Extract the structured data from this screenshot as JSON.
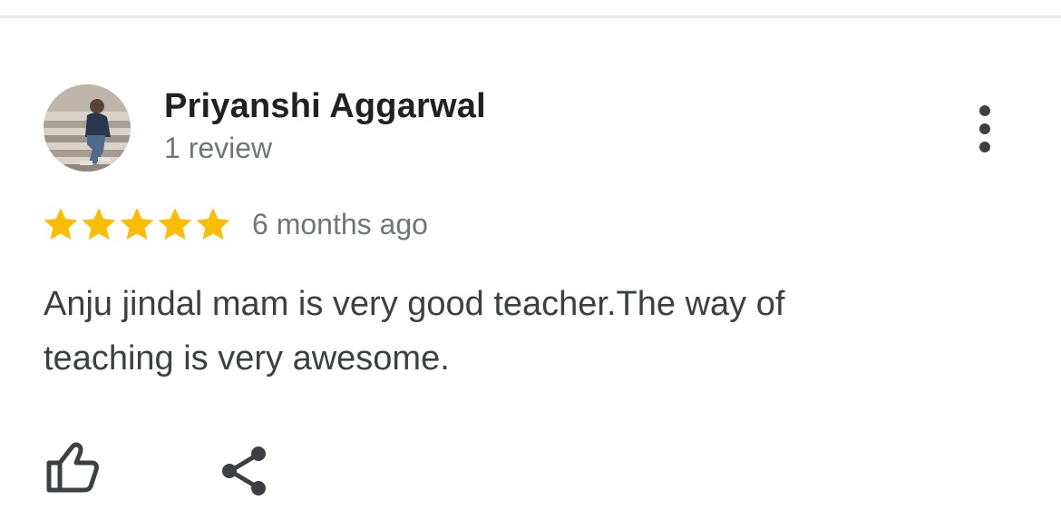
{
  "review": {
    "author": {
      "name": "Priyanshi Aggarwal",
      "review_count": "1 review",
      "avatar_icon": "user-avatar-photo"
    },
    "rating": {
      "stars": 5,
      "max_stars": 5,
      "star_color": "#fbbc04",
      "star_icon": "star-icon"
    },
    "date": "6 months ago",
    "text": "Anju jindal mam is very good teacher.The way of teaching is very awesome.",
    "actions": {
      "more_icon": "more-vert-icon",
      "like_icon": "thumb-up-icon",
      "share_icon": "share-icon"
    }
  },
  "colors": {
    "text_primary": "#202124",
    "text_secondary": "#70757a",
    "body_text": "#3c4043",
    "divider": "#e8eaed"
  }
}
